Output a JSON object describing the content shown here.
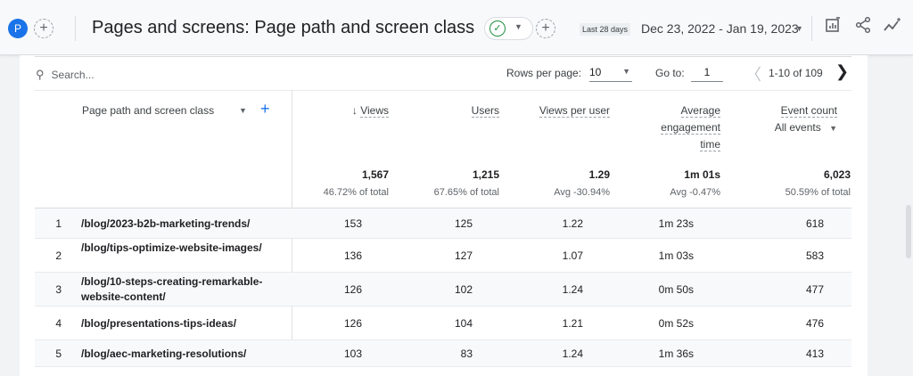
{
  "header": {
    "avatar": "P",
    "add": "+",
    "title": "Pages and screens: Page path and screen class",
    "status_icon": "check-circle-icon",
    "date_label": "Last 28 days",
    "date_range": "Dec 23, 2022 - Jan 19, 2023"
  },
  "toolbar": {
    "search_placeholder": "Search...",
    "rows_per_page_label": "Rows per page:",
    "rows_per_page": "10",
    "goto_label": "Go to:",
    "goto_value": "1",
    "range": "1-10 of 109"
  },
  "table": {
    "dimension_header": "Page path and screen class",
    "columns": [
      {
        "label": "Views",
        "sort": "↓",
        "total": "1,567",
        "sub": "46.72% of total"
      },
      {
        "label": "Users",
        "total": "1,215",
        "sub": "67.65% of total"
      },
      {
        "label": "Views per user",
        "total": "1.29",
        "sub": "Avg -30.94%"
      },
      {
        "label": "Average engagement time",
        "total": "1m 01s",
        "sub": "Avg -0.47%"
      },
      {
        "label": "Event count",
        "filter": "All events",
        "total": "6,023",
        "sub": "50.59% of total"
      }
    ],
    "rows": [
      {
        "n": "1",
        "path": "/blog/2023-b2b-marketing-trends/",
        "views": "153",
        "users": "125",
        "vpu": "1.22",
        "time": "1m 23s",
        "events": "618"
      },
      {
        "n": "2",
        "path": "/blog/tips-optimize-website-images/",
        "views": "136",
        "users": "127",
        "vpu": "1.07",
        "time": "1m 03s",
        "events": "583"
      },
      {
        "n": "3",
        "path": "/blog/10-steps-creating-remarkable-website-content/",
        "views": "126",
        "users": "102",
        "vpu": "1.24",
        "time": "0m 50s",
        "events": "477"
      },
      {
        "n": "4",
        "path": "/blog/presentations-tips-ideas/",
        "views": "126",
        "users": "104",
        "vpu": "1.21",
        "time": "0m 52s",
        "events": "476"
      },
      {
        "n": "5",
        "path": "/blog/aec-marketing-resolutions/",
        "views": "103",
        "users": "83",
        "vpu": "1.24",
        "time": "1m 36s",
        "events": "413"
      }
    ]
  }
}
